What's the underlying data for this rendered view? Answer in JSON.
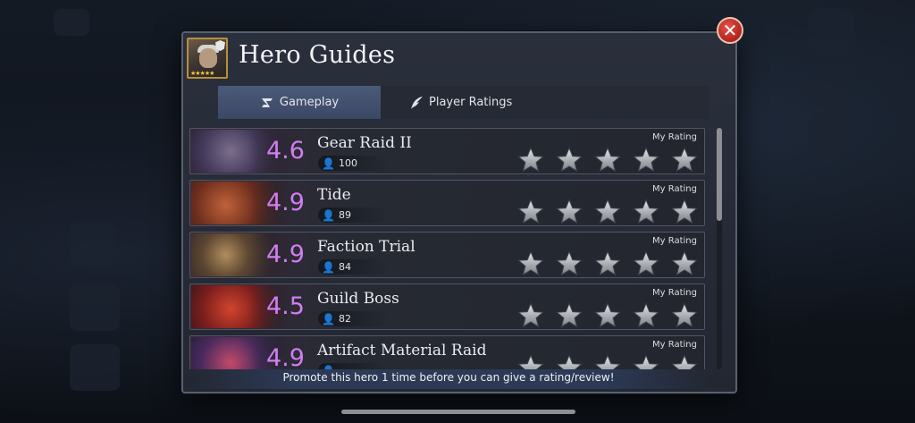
{
  "dialog": {
    "title": "Hero Guides",
    "portrait_stars": "★★★★★"
  },
  "close_button": {
    "label": "✕"
  },
  "tabs": [
    {
      "label": "Gameplay",
      "active": true
    },
    {
      "label": "Player Ratings",
      "active": false
    }
  ],
  "guides": [
    {
      "score": "4.6",
      "name": "Gear Raid II",
      "count": "100",
      "my_rating_label": "My Rating",
      "stars": 5
    },
    {
      "score": "4.9",
      "name": "Tide",
      "count": "89",
      "my_rating_label": "My Rating",
      "stars": 5
    },
    {
      "score": "4.9",
      "name": "Faction Trial",
      "count": "84",
      "my_rating_label": "My Rating",
      "stars": 5
    },
    {
      "score": "4.5",
      "name": "Guild Boss",
      "count": "82",
      "my_rating_label": "My Rating",
      "stars": 5
    },
    {
      "score": "4.9",
      "name": "Artifact Material Raid",
      "count": "",
      "my_rating_label": "My Rating",
      "stars": 5
    }
  ],
  "notice": "Promote this hero 1 time before you can give a rating/review!",
  "colors": {
    "score": "#d07ef0",
    "active_tab": "#46557a",
    "close": "#c7342b"
  }
}
